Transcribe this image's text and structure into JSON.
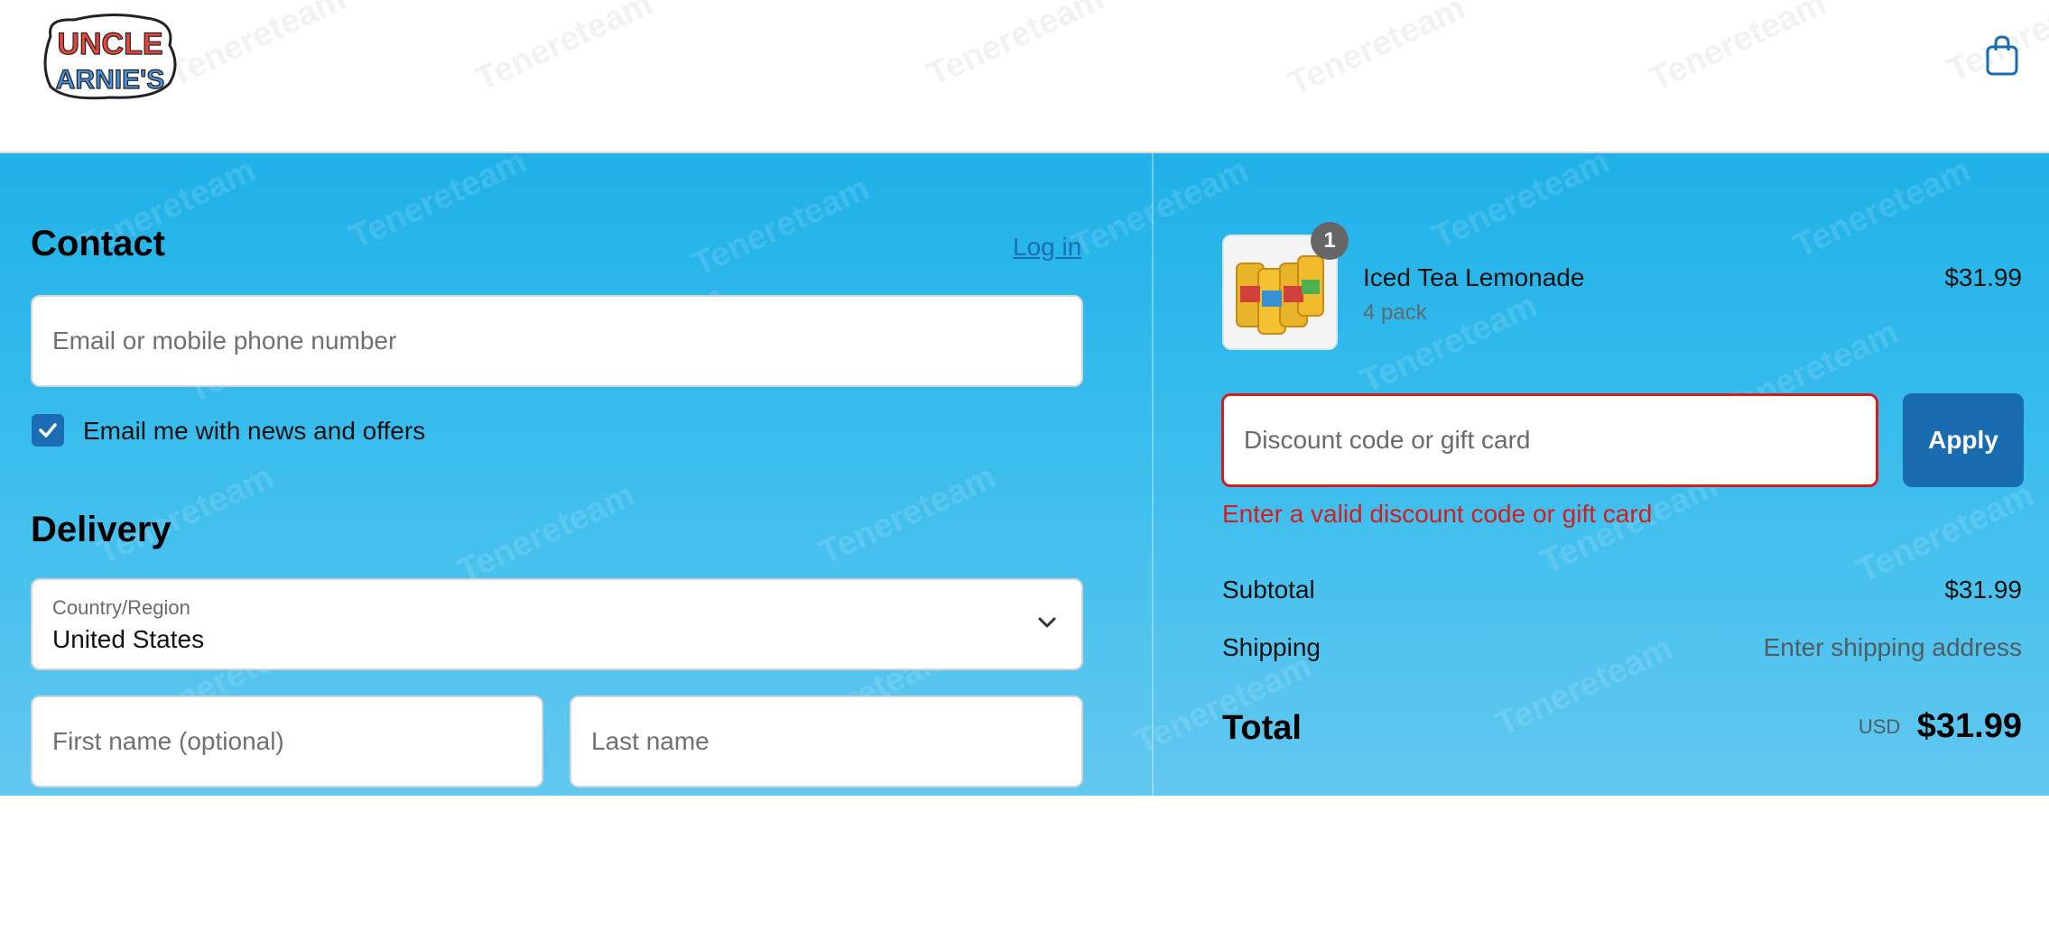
{
  "header": {
    "logo_text": "UNCLE ARNIE'S",
    "cart_icon": "shopping-bag-icon"
  },
  "watermark": {
    "text": "Tenereteam"
  },
  "contact": {
    "title": "Contact",
    "login_label": "Log in",
    "email_placeholder": "Email or mobile phone number",
    "newsletter_label": "Email me with news and offers",
    "newsletter_checked": true
  },
  "delivery": {
    "title": "Delivery",
    "country_label": "Country/Region",
    "country_value": "United States",
    "first_name_placeholder": "First name (optional)",
    "last_name_placeholder": "Last name"
  },
  "order": {
    "product": {
      "name": "Iced Tea Lemonade",
      "variant": "4 pack",
      "price": "$31.99",
      "quantity": "1"
    },
    "discount": {
      "placeholder": "Discount code or gift card",
      "apply_label": "Apply",
      "error": "Enter a valid discount code or gift card"
    },
    "subtotal_label": "Subtotal",
    "subtotal_value": "$31.99",
    "shipping_label": "Shipping",
    "shipping_value": "Enter shipping address",
    "total_label": "Total",
    "currency": "USD",
    "total_value": "$31.99"
  },
  "colors": {
    "accent": "#1a6cb0",
    "error": "#d21e1e",
    "background": "#2ab5ea"
  }
}
